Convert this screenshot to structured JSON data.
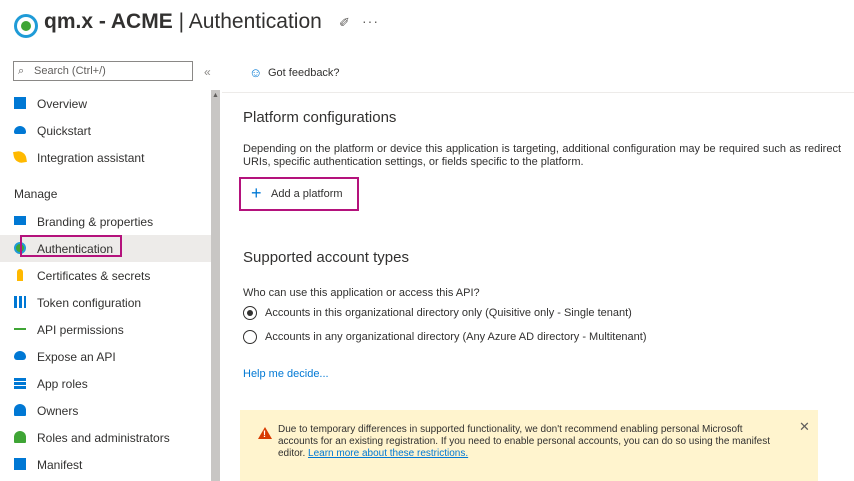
{
  "header": {
    "title_bold": "qm.x - ACME",
    "title_separator": " | ",
    "title_page": "Authentication",
    "pin_icon": "pin-icon",
    "more_label": "···"
  },
  "sidebar": {
    "search_placeholder": "Search (Ctrl+/)",
    "collapse_label": "«",
    "section_manage": "Manage",
    "items": [
      {
        "label": "Overview",
        "icon": "grid-icon",
        "color": "#0078d4"
      },
      {
        "label": "Quickstart",
        "icon": "cloud-icon",
        "color": "#0078d4"
      },
      {
        "label": "Integration assistant",
        "icon": "rocket-icon",
        "color": "#ffb900"
      },
      {
        "label": "Branding & properties",
        "icon": "branding-icon",
        "color": "#0078d4"
      },
      {
        "label": "Authentication",
        "icon": "auth-icon",
        "color": "#3fa535",
        "selected": true
      },
      {
        "label": "Certificates & secrets",
        "icon": "key-icon",
        "color": "#ffb900"
      },
      {
        "label": "Token configuration",
        "icon": "token-icon",
        "color": "#0078d4"
      },
      {
        "label": "API permissions",
        "icon": "api-icon",
        "color": "#3fa535"
      },
      {
        "label": "Expose an API",
        "icon": "cloud-icon",
        "color": "#0078d4"
      },
      {
        "label": "App roles",
        "icon": "roles-icon",
        "color": "#0078d4"
      },
      {
        "label": "Owners",
        "icon": "owners-icon",
        "color": "#0078d4"
      },
      {
        "label": "Roles and administrators",
        "icon": "admin-icon",
        "color": "#3fa535"
      },
      {
        "label": "Manifest",
        "icon": "manifest-icon",
        "color": "#0078d4"
      }
    ]
  },
  "main": {
    "feedback_label": "Got feedback?",
    "platform_heading": "Platform configurations",
    "platform_desc": "Depending on the platform or device this application is targeting, additional configuration may be required such as redirect URIs, specific authentication settings, or fields specific to the platform.",
    "add_platform_label": "Add a platform",
    "account_heading": "Supported account types",
    "account_question": "Who can use this application or access this API?",
    "options": [
      {
        "label": "Accounts in this organizational directory only (Quisitive only - Single tenant)",
        "checked": true
      },
      {
        "label": "Accounts in any organizational directory (Any Azure AD directory - Multitenant)",
        "checked": false
      }
    ],
    "help_link": "Help me decide...",
    "warning": {
      "text": "Due to temporary differences in supported functionality, we don't recommend enabling personal Microsoft accounts for an existing registration. If you need to enable personal accounts, you can do so using the manifest editor.",
      "link": "Learn more about these restrictions."
    }
  },
  "colors": {
    "accent": "#0078d4",
    "highlight": "#b4127c",
    "warning_bg": "#fff4ce",
    "warning_icon": "#d83b01"
  }
}
